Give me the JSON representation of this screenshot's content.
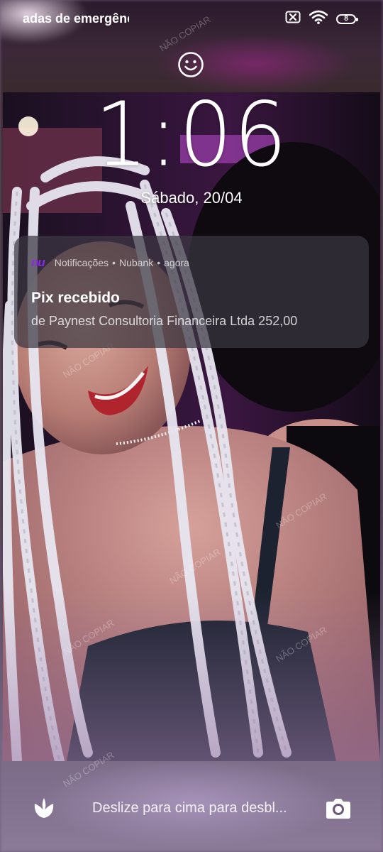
{
  "status_bar": {
    "left_text": "adas de emergência",
    "battery_level": "8",
    "icons": [
      "sim-off-icon",
      "wifi-icon",
      "battery-icon"
    ]
  },
  "lock_screen": {
    "face_icon": "smiley-icon",
    "time": "1:06",
    "date": "Sábado, 20/04"
  },
  "notification": {
    "app_icon": "nubank-icon",
    "app_logo_text": "nu",
    "channel": "Notificações",
    "app_name": "Nubank",
    "separator": "•",
    "time": "agora",
    "title": "Pix recebido",
    "body": "de Paynest Consultoria Financeira Ltda 252,00"
  },
  "watermark_text": "NÃO COPIAR",
  "bottom_bar": {
    "left_icon": "leaf-icon",
    "hint": "Deslize para cima para desbl...",
    "right_icon": "camera-icon"
  },
  "colors": {
    "nubank_purple": "#8a2be2",
    "notification_bg": "#3c3842"
  }
}
